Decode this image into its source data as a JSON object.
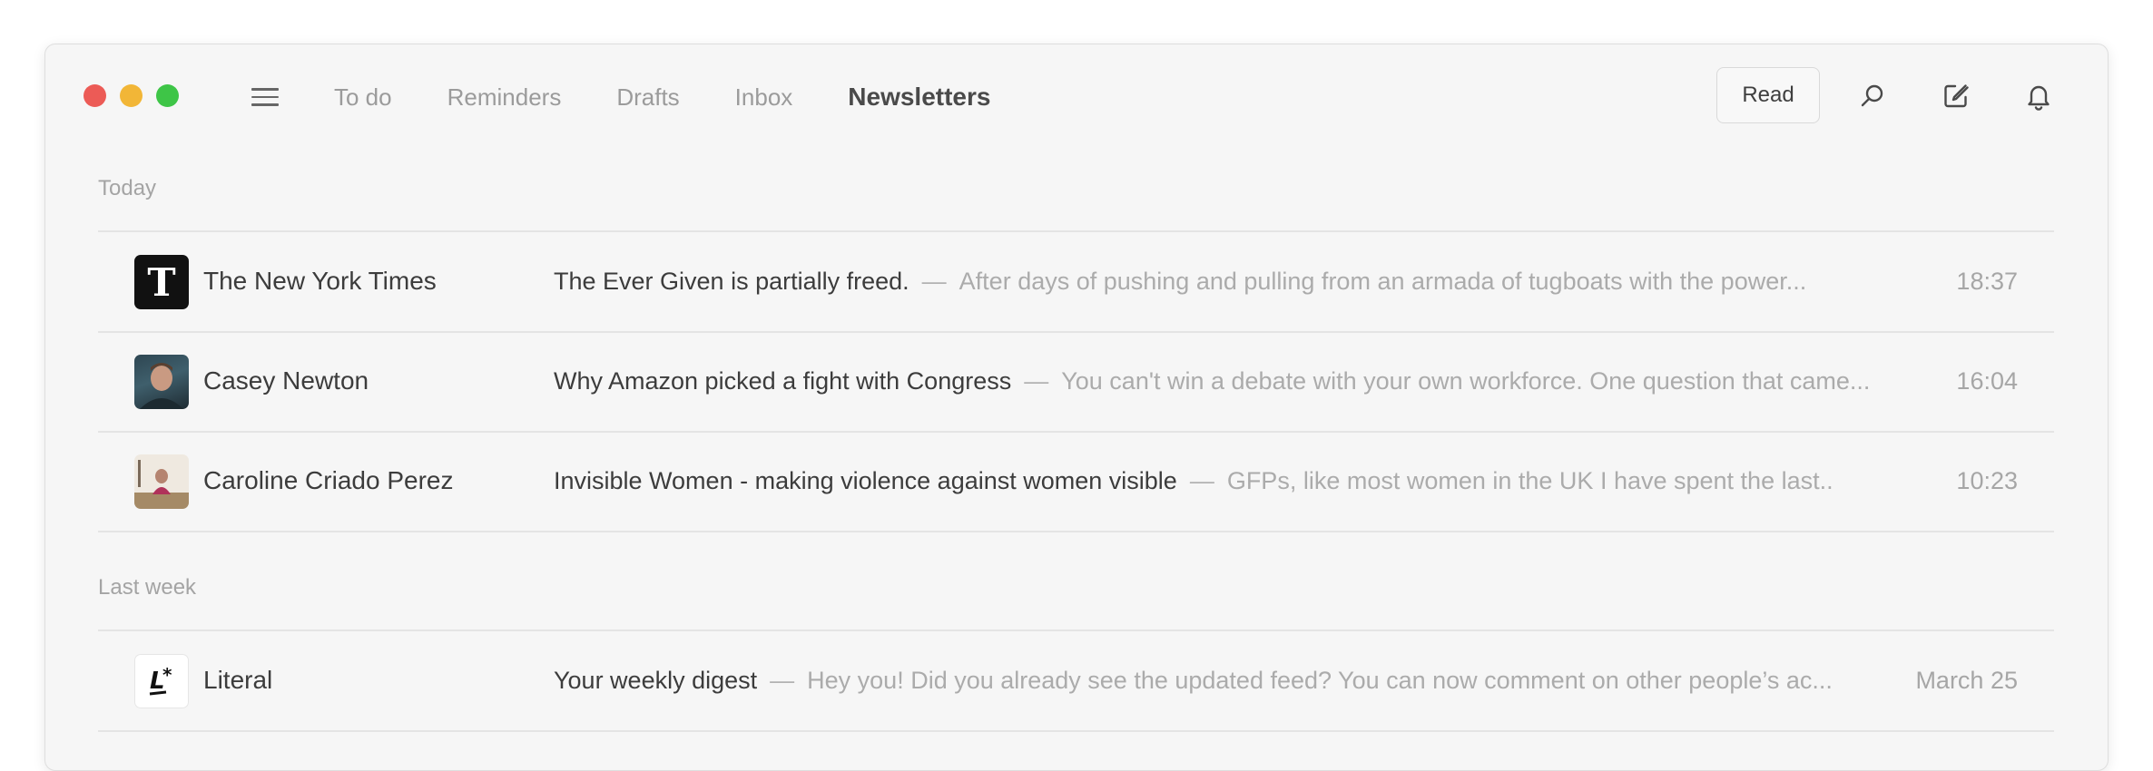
{
  "window": {
    "colors": {
      "close": "#ec5b56",
      "minimize": "#f2b637",
      "zoom": "#3ec547"
    }
  },
  "nav": {
    "menu_icon": "hamburger-icon",
    "tabs": [
      {
        "label": "To do"
      },
      {
        "label": "Reminders"
      },
      {
        "label": "Drafts"
      },
      {
        "label": "Inbox"
      },
      {
        "label": "Newsletters",
        "active": true
      }
    ]
  },
  "toolbar": {
    "read_label": "Read",
    "icons": [
      "search-icon",
      "compose-icon",
      "bell-icon"
    ]
  },
  "sections": [
    {
      "label": "Today",
      "items": [
        {
          "sender": "The New York Times",
          "avatar": "nyt-logo",
          "subject": "The Ever Given is partially freed.",
          "separator": "—",
          "preview": "After days of pushing and pulling from an armada of tugboats with the power...",
          "time": "18:37"
        },
        {
          "sender": "Casey Newton",
          "avatar": "person-photo",
          "subject": "Why Amazon picked a fight with Congress",
          "separator": "—",
          "preview": "You can't win a debate with your own workforce. One question that came...",
          "time": "16:04"
        },
        {
          "sender": "Caroline Criado Perez",
          "avatar": "person-photo",
          "subject": "Invisible Women - making violence against women visible",
          "separator": "—",
          "preview": "GFPs, like most women in the UK I have spent the last..",
          "time": "10:23"
        }
      ]
    },
    {
      "label": "Last week",
      "items": [
        {
          "sender": "Literal",
          "avatar": "literal-logo",
          "subject": "Your weekly digest",
          "separator": "—",
          "preview": "Hey you! Did you already see the updated feed? You can now comment on other people’s ac...",
          "time": "March 25"
        }
      ]
    }
  ]
}
